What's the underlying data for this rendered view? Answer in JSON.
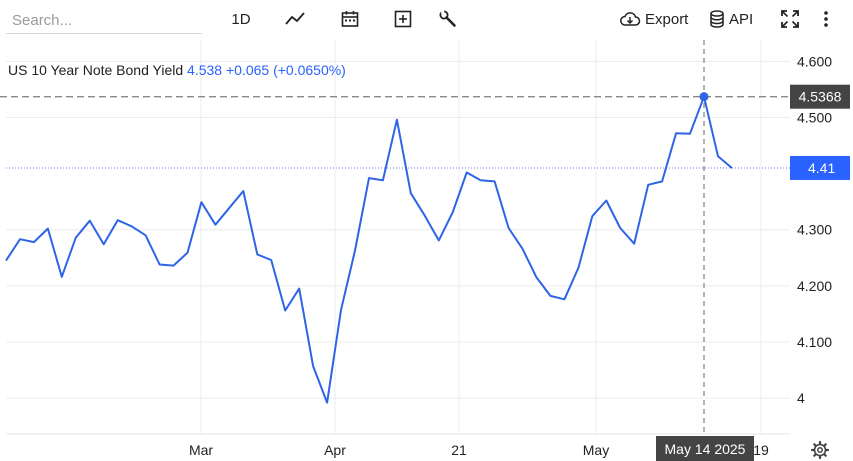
{
  "toolbar": {
    "search_placeholder": "Search...",
    "interval_label": "1D",
    "export_label": "Export",
    "api_label": "API",
    "icons": [
      "line-chart-icon",
      "calendar-icon",
      "add-square-icon",
      "wrench-icon",
      "cloud-download-icon",
      "database-icon",
      "fullscreen-icon",
      "more-vertical-icon",
      "gear-icon"
    ]
  },
  "header": {
    "instrument": "US 10 Year Note Bond Yield",
    "price": "4.538",
    "change": "+0.065",
    "change_pct": "(+0.0650%)"
  },
  "crosshair": {
    "price_label": "4.5368",
    "date_label": "May 14 2025"
  },
  "last_price": {
    "label": "4.41"
  },
  "colors": {
    "line": "#2e64e6",
    "price_badge": "#2962ff",
    "crosshair_badge": "#444444"
  },
  "chart_data": {
    "type": "line",
    "y_tick_labels": [
      "4",
      "4.100",
      "4.200",
      "4.300",
      "4.500",
      "4.600"
    ],
    "y_ticks": [
      4.0,
      4.1,
      4.2,
      4.3,
      4.5,
      4.6
    ],
    "ylim": [
      3.936,
      4.638
    ],
    "x_tick_labels": [
      "Mar",
      "Apr",
      "21",
      "May",
      "19"
    ],
    "grid": true,
    "series": [
      {
        "values": [
          4.245,
          4.283,
          4.278,
          4.302,
          4.216,
          4.286,
          4.316,
          4.274,
          4.317,
          4.306,
          4.29,
          4.238,
          4.236,
          4.259,
          4.349,
          4.309,
          4.339,
          4.369,
          4.256,
          4.246,
          4.156,
          4.195,
          4.057,
          3.992,
          4.157,
          4.263,
          4.392,
          4.388,
          4.496,
          4.365,
          4.325,
          4.281,
          4.331,
          4.402,
          4.388,
          4.386,
          4.303,
          4.266,
          4.215,
          4.182,
          4.176,
          4.232,
          4.324,
          4.352,
          4.303,
          4.275,
          4.38,
          4.386,
          4.472,
          4.471,
          4.537,
          4.431,
          4.41
        ]
      }
    ]
  }
}
